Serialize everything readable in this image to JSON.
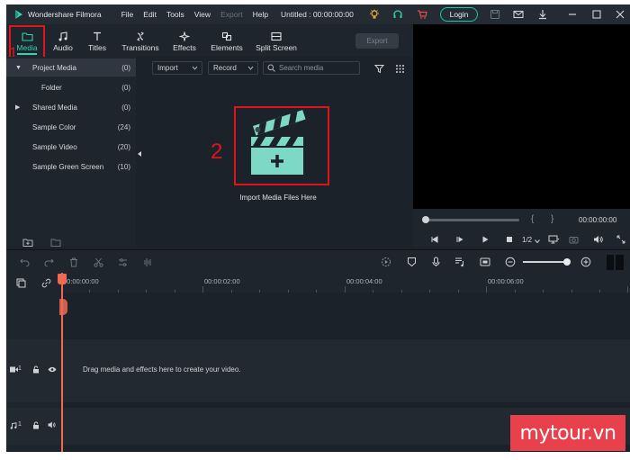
{
  "app": {
    "name": "Wondershare Filmora",
    "document_title": "Untitled : 00:00:00:00"
  },
  "menu": [
    "File",
    "Edit",
    "Tools",
    "View",
    "Export",
    "Help"
  ],
  "titlebar": {
    "login_label": "Login"
  },
  "tabs": [
    {
      "label": "Media",
      "icon": "folder-icon",
      "active": true
    },
    {
      "label": "Audio",
      "icon": "music-note-icon"
    },
    {
      "label": "Titles",
      "icon": "title-t-icon"
    },
    {
      "label": "Transitions",
      "icon": "transition-icon"
    },
    {
      "label": "Effects",
      "icon": "effects-sparkle-icon"
    },
    {
      "label": "Elements",
      "icon": "elements-icon"
    },
    {
      "label": "Split Screen",
      "icon": "split-screen-icon"
    }
  ],
  "toolbar": {
    "export_label": "Export"
  },
  "media_tree": [
    {
      "name": "Project Media",
      "count": "(0)",
      "expanded": true,
      "selected": true
    },
    {
      "name": "Folder",
      "count": "(0)"
    },
    {
      "name": "Shared Media",
      "count": "(0)",
      "collapsed": true
    },
    {
      "name": "Sample Color",
      "count": "(24)"
    },
    {
      "name": "Sample Video",
      "count": "(20)"
    },
    {
      "name": "Sample Green Screen",
      "count": "(10)"
    }
  ],
  "media": {
    "import_dropdown": "Import",
    "record_dropdown": "Record",
    "search_placeholder": "Search media",
    "import_label": "Import Media Files Here"
  },
  "annotations": {
    "step1": "1",
    "step2": "2"
  },
  "preview": {
    "timecode": "00:00:00:00",
    "quality": "1/2",
    "brace_left": "{",
    "brace_right": "}"
  },
  "timeline": {
    "ticks": [
      "00:00:00:00",
      "00:00:02:00",
      "00:00:04:00",
      "00:00:06:00"
    ],
    "drag_hint": "Drag media and effects here to create your video.",
    "video_track_num": "1",
    "audio_track_num": "1"
  },
  "watermark": "mytour.vn",
  "colors": {
    "accent": "#2fd4b3",
    "annotation_red": "#e3131b",
    "playhead": "#ef6a52",
    "clapper": "#7ed8c6"
  }
}
